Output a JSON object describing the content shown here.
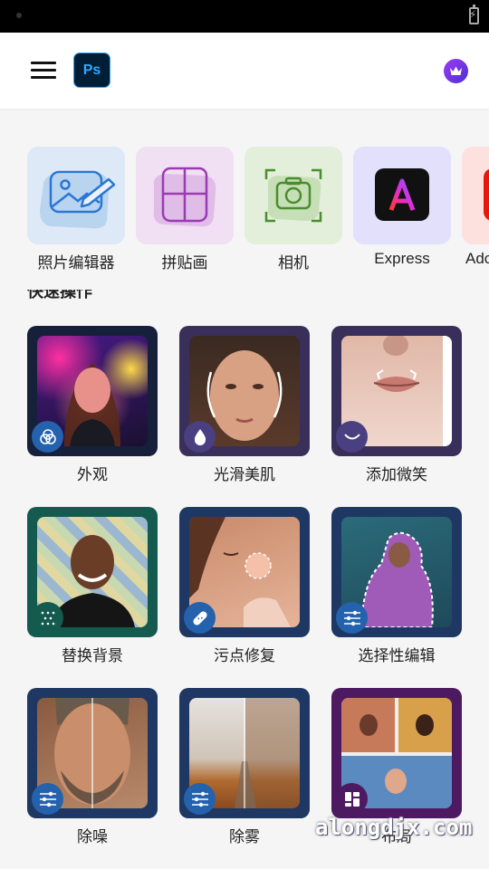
{
  "app": {
    "logo_text": "Ps",
    "accent": "#31a8ff",
    "premium_icon": "crown-icon"
  },
  "tools": [
    {
      "label": "照片编辑器",
      "icon": "photo-edit-icon",
      "bg": "#dde9f6"
    },
    {
      "label": "拼贴画",
      "icon": "collage-icon",
      "bg": "#f1dff3"
    },
    {
      "label": "相机",
      "icon": "camera-icon",
      "bg": "#e3eedb"
    },
    {
      "label": "Express",
      "icon": "adobe-express-icon",
      "bg": "#e2e0fb"
    },
    {
      "label": "Ado",
      "icon": "adobe-icon",
      "bg": "#fde1df"
    }
  ],
  "section": {
    "title": "快速操作"
  },
  "actions": [
    {
      "label": "外观",
      "badge_icon": "looks-icon"
    },
    {
      "label": "光滑美肌",
      "badge_icon": "drop-icon"
    },
    {
      "label": "添加微笑",
      "badge_icon": "smile-icon"
    },
    {
      "label": "替换背景",
      "badge_icon": "pattern-icon"
    },
    {
      "label": "污点修复",
      "badge_icon": "bandage-icon"
    },
    {
      "label": "选择性编辑",
      "badge_icon": "sliders-icon"
    },
    {
      "label": "除噪",
      "badge_icon": "sliders-icon"
    },
    {
      "label": "除雾",
      "badge_icon": "sliders-icon"
    },
    {
      "label": "布局",
      "badge_icon": "layout-icon"
    }
  ],
  "watermark": "alongdjx.com"
}
